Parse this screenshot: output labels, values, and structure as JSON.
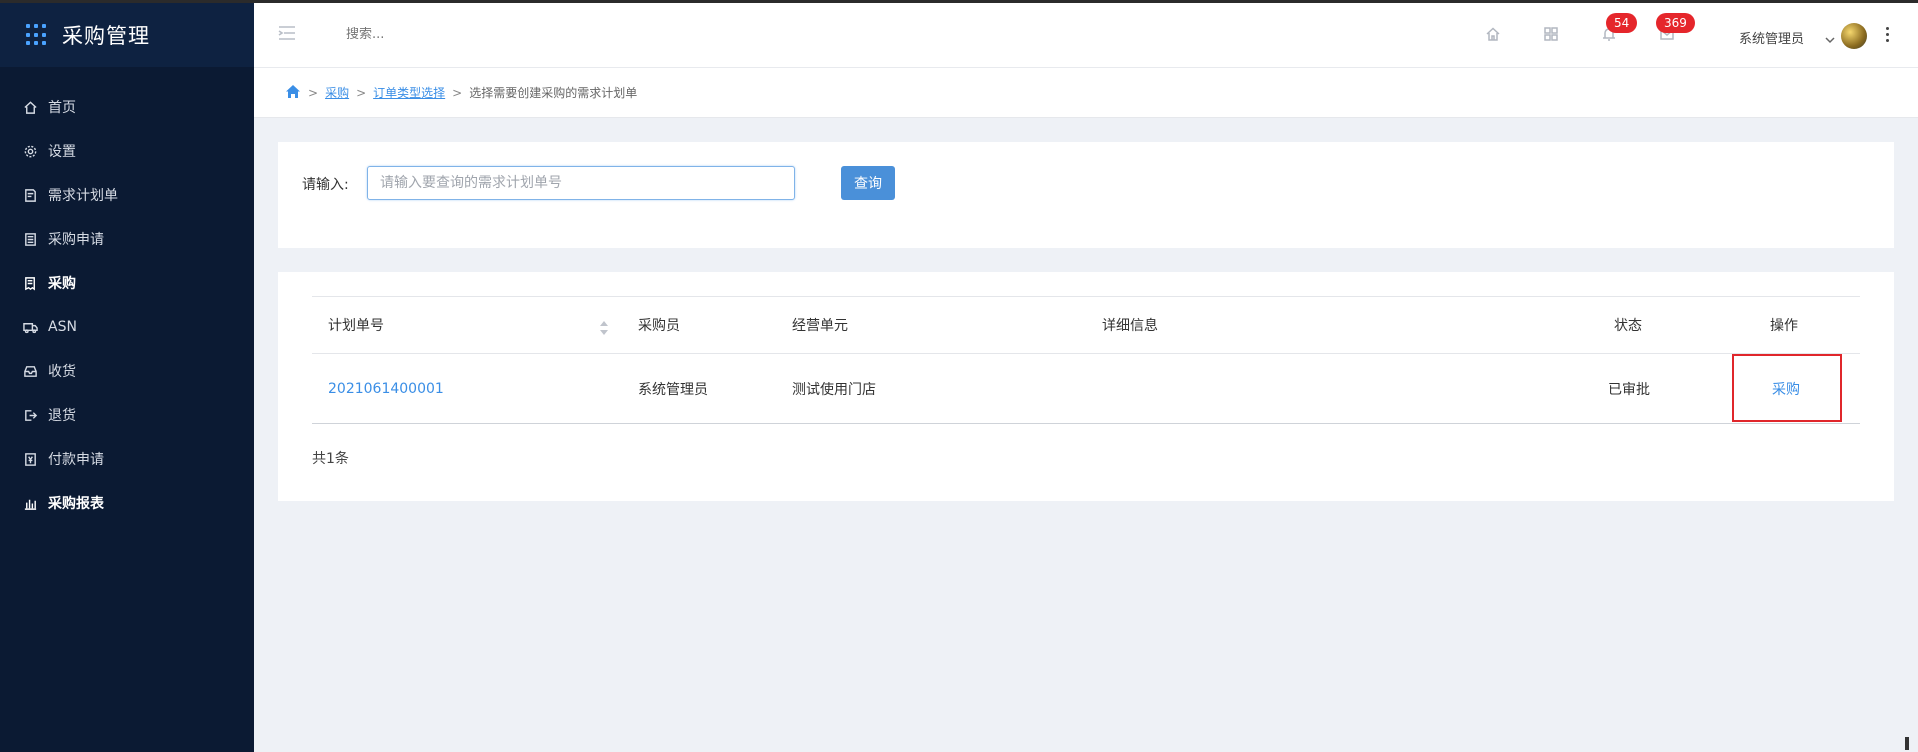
{
  "sidebar": {
    "title": "采购管理",
    "items": [
      {
        "label": "首页",
        "icon": "home-icon",
        "active": false
      },
      {
        "label": "设置",
        "icon": "gear-icon",
        "active": false
      },
      {
        "label": "需求计划单",
        "icon": "document-icon",
        "active": false
      },
      {
        "label": "采购申请",
        "icon": "clipboard-icon",
        "active": false
      },
      {
        "label": "采购",
        "icon": "receipt-icon",
        "active": true
      },
      {
        "label": "ASN",
        "icon": "truck-icon",
        "active": false
      },
      {
        "label": "收货",
        "icon": "inbox-icon",
        "active": false
      },
      {
        "label": "退货",
        "icon": "exit-icon",
        "active": false
      },
      {
        "label": "付款申请",
        "icon": "payment-icon",
        "active": false
      },
      {
        "label": "采购报表",
        "icon": "bar-chart-icon",
        "active": true
      }
    ]
  },
  "header": {
    "search_placeholder": "搜索...",
    "notifications_badge": "54",
    "messages_badge": "369",
    "user_name": "系统管理员"
  },
  "breadcrumb": {
    "items": [
      "采购",
      "订单类型选择"
    ],
    "current": "选择需要创建采购的需求计划单",
    "separator": ">"
  },
  "search": {
    "label": "请输入:",
    "placeholder": "请输入要查询的需求计划单号",
    "value": "",
    "button_label": "查询"
  },
  "table": {
    "columns": [
      "计划单号",
      "采购员",
      "经营单元",
      "详细信息",
      "状态",
      "操作"
    ],
    "rows": [
      {
        "plan_no": "2021061400001",
        "buyer": "系统管理员",
        "business_unit": "测试使用门店",
        "details": "",
        "status": "已审批",
        "action": "采购"
      }
    ],
    "total": "共1条"
  },
  "colors": {
    "sidebar_bg": "#0b1a33",
    "accent": "#3a8ee6",
    "button": "#4a90d9",
    "badge": "#e5262b",
    "highlight_box": "#e0262b"
  }
}
